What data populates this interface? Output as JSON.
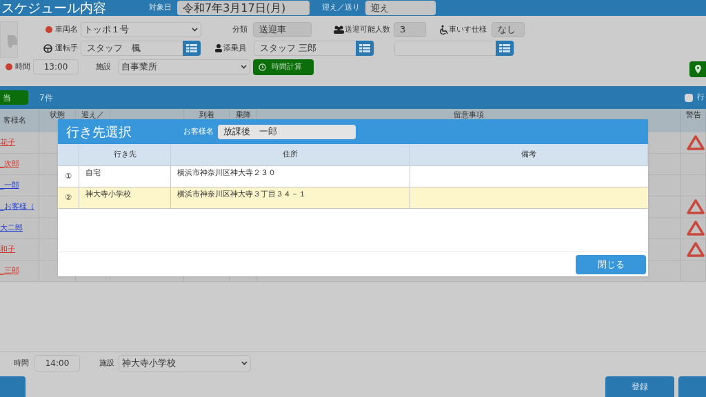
{
  "header": {
    "title": "スケジュール内容",
    "date_label": "対象日",
    "date": "令和7年3月17日(月)",
    "direction_label": "迎え／送り",
    "direction": "迎え"
  },
  "vehicle": {
    "vehicle_label": "車両名",
    "vehicle_required": true,
    "vehicle": "トッポ１号",
    "category_label": "分類",
    "category": "送迎車",
    "capacity_label": "送迎可能人数",
    "capacity": "3",
    "wheelchair_label": "車いす仕様",
    "wheelchair": "なし",
    "driver_label": "運転手",
    "driver": "スタッフ　楓",
    "escort_label": "添乗員",
    "escort": "スタッフ 三郎",
    "time_label": "時間",
    "time_required": true,
    "time": "13:00",
    "facility_label": "施設",
    "facility": "自事業所",
    "calc_button": "時間計算"
  },
  "list_bar": {
    "assign_button": "当",
    "count": "7件",
    "checkbox": {
      "label": "行",
      "checked": false
    }
  },
  "table": {
    "columns": [
      "客様名",
      "状態",
      "迎え／",
      "到着",
      "乗降",
      "留意事項",
      "警告"
    ],
    "rows": [
      {
        "name": "花子",
        "color": "#d5382e",
        "warning": true
      },
      {
        "name": "_次郎",
        "color": "#d5382e",
        "warning": false
      },
      {
        "name": "_一郎",
        "color": "#1f3ccf",
        "warning": false
      },
      {
        "name": "_お客様（",
        "color": "#1f3ccf",
        "warning": true
      },
      {
        "name": "大二郎",
        "color": "#1f3ccf",
        "warning": true
      },
      {
        "name": "和子",
        "color": "#d5382e",
        "warning": true
      },
      {
        "name": "_三郎",
        "color": "#d5382e",
        "warning": false
      }
    ]
  },
  "footer_form": {
    "time_label": "時間",
    "time": "14:00",
    "facility_label": "施設",
    "facility": "神大寺小学校"
  },
  "footer_buttons": [
    "登録"
  ],
  "dialog": {
    "title": "行き先選択",
    "customer_label": "お客様名",
    "customer": "放課後　一郎",
    "columns": [
      "行き先",
      "住所",
      "備考"
    ],
    "rows": [
      {
        "number": "①",
        "destination": "自宅",
        "address": "横浜市神奈川区神大寺２３０",
        "selected": false
      },
      {
        "number": "②",
        "destination": "神大寺小学校",
        "address": "横浜市神奈川区神大寺３丁目３４－１",
        "selected": true
      }
    ],
    "close_button": "閉じる"
  }
}
